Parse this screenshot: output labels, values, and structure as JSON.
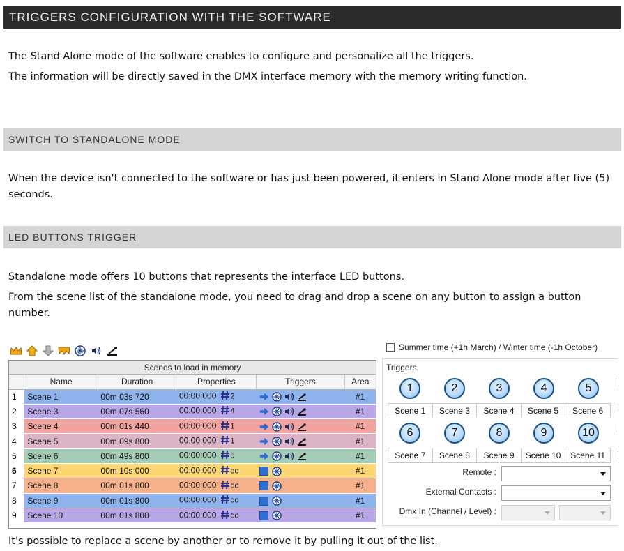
{
  "sections": {
    "title": "TRIGGERS CONFIGURATION WITH THE SOFTWARE",
    "intro_1": "The Stand Alone mode of the software enables to configure and personalize all the triggers.",
    "intro_2": "The information will be directly saved in the DMX interface memory with the memory writing function.",
    "switch_heading": "SWITCH TO STANDALONE MODE",
    "switch_text": "When the device isn't connected to the software or has just been powered, it enters in Stand Alone mode after five (5) seconds.",
    "led_heading": "LED BUTTONS TRIGGER",
    "led_text_1": "Standalone mode offers 10 buttons that represents the interface LED buttons.",
    "led_text_2": "From the scene list of the standalone mode, you need to drag and drop a scene on any button to assign a button number.",
    "footer_text": "It's possible to replace a scene by another or to remove it by pulling it out of the list."
  },
  "scene_table": {
    "title": "Scenes to load in memory",
    "headers": {
      "name": "Name",
      "duration": "Duration",
      "properties": "Properties",
      "triggers": "Triggers",
      "area": "Area"
    },
    "rows": [
      {
        "idx": "1",
        "name": "Scene 1",
        "duration": "00m 03s 720",
        "time": "00:00:000",
        "pnum": "2",
        "full": true,
        "area": "#1",
        "color": "#8fb3ec",
        "bold": false
      },
      {
        "idx": "2",
        "name": "Scene 3",
        "duration": "00m 07s 560",
        "time": "00:00:000",
        "pnum": "4",
        "full": true,
        "area": "#1",
        "color": "#b9a6e6",
        "bold": false
      },
      {
        "idx": "3",
        "name": "Scene 4",
        "duration": "00m 01s 440",
        "time": "00:00:000",
        "pnum": "1",
        "full": true,
        "area": "#1",
        "color": "#f1a39f",
        "bold": false
      },
      {
        "idx": "4",
        "name": "Scene 5",
        "duration": "00m 09s 800",
        "time": "00:00:000",
        "pnum": "1",
        "full": true,
        "area": "#1",
        "color": "#dcb4c7",
        "bold": false
      },
      {
        "idx": "5",
        "name": "Scene 6",
        "duration": "00m 49s 800",
        "time": "00:00:000",
        "pnum": "5",
        "full": true,
        "area": "#1",
        "color": "#a4cbb6",
        "bold": false
      },
      {
        "idx": "6",
        "name": "Scene 7",
        "duration": "00m 10s 000",
        "time": "00:00:000",
        "pnum": "oo",
        "full": false,
        "area": "#1",
        "color": "#fbd673",
        "bold": true
      },
      {
        "idx": "7",
        "name": "Scene 8",
        "duration": "00m 01s 800",
        "time": "00:00:000",
        "pnum": "oo",
        "full": false,
        "area": "#1",
        "color": "#f7b18a",
        "bold": false
      },
      {
        "idx": "8",
        "name": "Scene 9",
        "duration": "00m 01s 800",
        "time": "00:00:000",
        "pnum": "oo",
        "full": false,
        "area": "#1",
        "color": "#8fb3ec",
        "bold": false
      },
      {
        "idx": "9",
        "name": "Scene 10",
        "duration": "00m 01s 800",
        "time": "00:00:000",
        "pnum": "oo",
        "full": false,
        "area": "#1",
        "color": "#b9a6e6",
        "bold": false
      }
    ]
  },
  "right_panel": {
    "summer_label": "Summer time (+1h March) / Winter time (-1h October)",
    "triggers_label": "Triggers",
    "buttons_top": [
      "1",
      "2",
      "3",
      "4",
      "5"
    ],
    "labels_top": [
      "Scene 1",
      "Scene 3",
      "Scene 4",
      "Scene 5",
      "Scene 6"
    ],
    "buttons_bottom": [
      "6",
      "7",
      "8",
      "9",
      "10"
    ],
    "labels_bottom": [
      "Scene 7",
      "Scene 8",
      "Scene 9",
      "Scene 10",
      "Scene 11"
    ],
    "remote_label": "Remote :",
    "contacts_label": "External Contacts :",
    "dmx_label": "Dmx In (Channel / Level) :"
  },
  "colors": {
    "dark_bar": "#2b2b2b",
    "light_bar": "#d5d5d5",
    "accent_blue": "#2e6fd3",
    "led_border": "#1c4f86"
  }
}
